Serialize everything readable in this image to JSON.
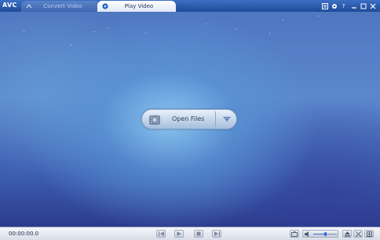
{
  "app": {
    "logo_text": "AVC"
  },
  "tabs": [
    {
      "label": "Convert Video",
      "active": false
    },
    {
      "label": "Play Video",
      "active": true
    }
  ],
  "window_controls": [
    "list-icon",
    "gear-icon",
    "help-icon",
    "minimize-icon",
    "maximize-icon",
    "close-icon"
  ],
  "window_help_glyph": "?",
  "open_files": {
    "label": "Open Files"
  },
  "player": {
    "time": "00:00:00.0",
    "volume_level": 0.5,
    "controls": [
      "previous-icon",
      "play-icon",
      "stop-icon",
      "next-icon"
    ]
  },
  "colors": {
    "titlebar": "#1e4a98",
    "stage_glow": "#8cc8f0",
    "accent": "#2f6fd0"
  }
}
